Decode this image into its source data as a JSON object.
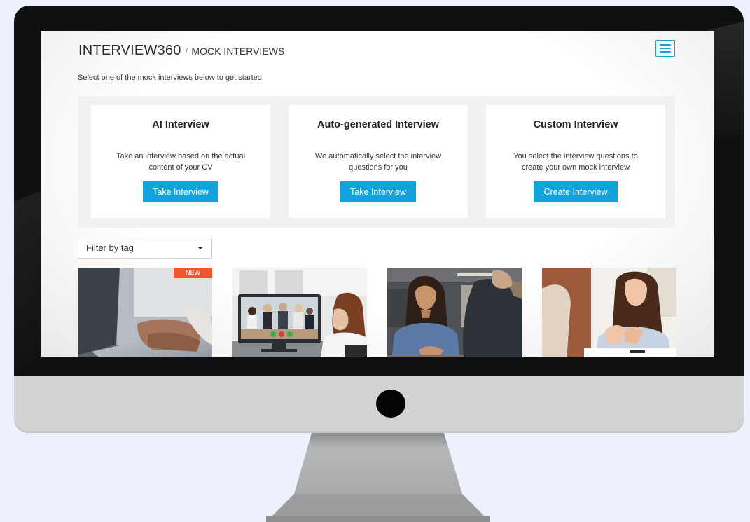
{
  "header": {
    "brand": "INTERVIEW360",
    "separator": "/",
    "breadcrumb": "MOCK INTERVIEWS"
  },
  "intro_text": "Select one of the mock interviews below to get started.",
  "cards": [
    {
      "title": "AI Interview",
      "description": "Take an interview based on the actual content of your CV",
      "button": "Take Interview"
    },
    {
      "title": "Auto-generated Interview",
      "description": "We automatically select the interview questions for you",
      "button": "Take Interview"
    },
    {
      "title": "Custom Interview",
      "description": "You select the interview questions to create your own mock interview",
      "button": "Create Interview"
    }
  ],
  "filter": {
    "label": "Filter by tag"
  },
  "thumbnails": [
    {
      "badge": "NEW"
    }
  ],
  "colors": {
    "accent": "#12a3dc",
    "badge": "#f2562e",
    "background": "#eef0fc",
    "bezel": "#0f1011"
  },
  "icons": {
    "menu": "hamburger-menu-icon",
    "dropdown": "caret-down-icon"
  }
}
